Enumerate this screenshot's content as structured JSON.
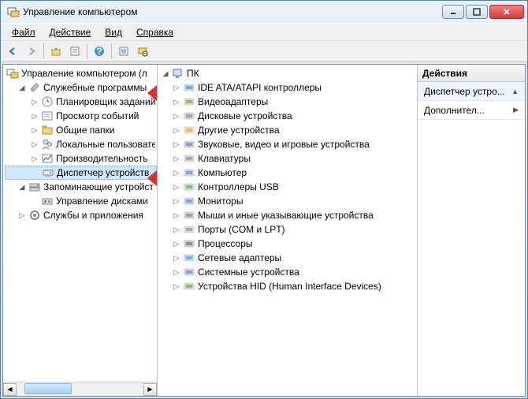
{
  "window": {
    "title": "Управление компьютером"
  },
  "menu": {
    "file": "Файл",
    "action": "Действие",
    "view": "Вид",
    "help": "Справка"
  },
  "left_tree": {
    "root": "Управление компьютером (л",
    "sys_tools": "Служебные программы",
    "sys_children": [
      "Планировщик заданий",
      "Просмотр событий",
      "Общие папки",
      "Локальные пользовате",
      "Производительность",
      "Диспетчер устройств"
    ],
    "storage": "Запоминающие устройст",
    "storage_children": [
      "Управление дисками"
    ],
    "services": "Службы и приложения"
  },
  "mid_tree": {
    "root": "ПК",
    "items": [
      "IDE ATA/ATAPI контроллеры",
      "Видеоадаптеры",
      "Дисковые устройства",
      "Другие устройства",
      "Звуковые, видео и игровые устройства",
      "Клавиатуры",
      "Компьютер",
      "Контроллеры USB",
      "Мониторы",
      "Мыши и иные указывающие устройства",
      "Порты (COM и LPT)",
      "Процессоры",
      "Сетевые адаптеры",
      "Системные устройства",
      "Устройства HID (Human Interface Devices)"
    ]
  },
  "actions": {
    "header": "Действия",
    "item1": "Диспетчер устро...",
    "item2": "Дополнител..."
  },
  "icons": {
    "device_colors": [
      "#5a8ac6",
      "#7aa050",
      "#808890",
      "#d0a040",
      "#7a70b0",
      "#909090",
      "#5a8ac6",
      "#6aa060",
      "#5a8ac6",
      "#808080",
      "#8a90a0",
      "#6a6a6a",
      "#5a90c8",
      "#5a8ac6",
      "#70a060"
    ]
  }
}
